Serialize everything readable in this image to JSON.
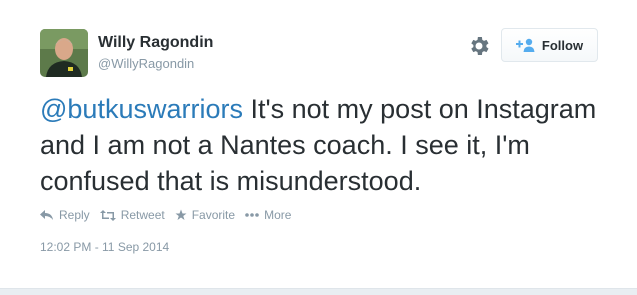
{
  "user": {
    "display_name": "Willy Ragondin",
    "screen_name": "@WillyRagondin"
  },
  "follow_button": {
    "label": "Follow"
  },
  "tweet": {
    "mention": "@butkuswarriors",
    "text": " It's not my post on Instagram and I am not a Nantes coach. I see it, I'm confused that is misunderstood.",
    "timestamp": "12:02 PM - 11 Sep 2014"
  },
  "actions": {
    "reply": "Reply",
    "retweet": "Retweet",
    "favorite": "Favorite",
    "more": "More"
  },
  "icons": {
    "settings": "gear-icon",
    "follow": "follow-user-icon",
    "reply": "reply-icon",
    "retweet": "retweet-icon",
    "favorite": "star-icon",
    "more": "more-dots-icon"
  },
  "colors": {
    "mention": "#2b7bb9",
    "muted": "#8899a6",
    "text": "#292f33"
  }
}
